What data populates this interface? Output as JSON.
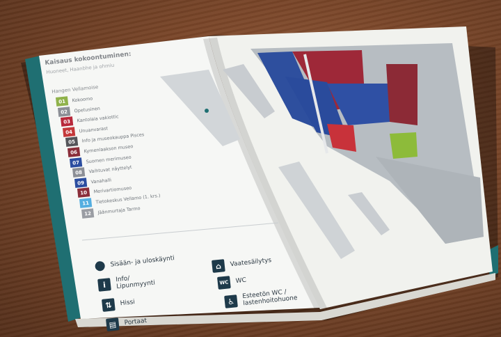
{
  "scene": {
    "description_colors": {
      "table": "#7a4a2e",
      "cover_teal": "#1f6f72",
      "page": "#f5f6f4"
    }
  },
  "left_page": {
    "title": "Kaisaus kokoontuminen:",
    "subtitle": "Huoneet, Haanbhe ja ohmiu",
    "section_heading": "Hangen Vellamoise",
    "legend": [
      {
        "num": "01",
        "label": "Kokoomo",
        "color": "#8fb24a"
      },
      {
        "num": "02",
        "label": "Opetusinen",
        "color": "#8c8f96"
      },
      {
        "num": "03",
        "label": "Kantolaia vakiottic",
        "color": "#b8283a"
      },
      {
        "num": "04",
        "label": "Unuanvarast",
        "color": "#c4383a"
      },
      {
        "num": "05",
        "label": "Info ja museokauppa Pisces",
        "color": "#55555a"
      },
      {
        "num": "06",
        "label": "Kymenlaakson museo",
        "color": "#8a2e3a"
      },
      {
        "num": "07",
        "label": "Suomen merimuseo",
        "color": "#2b4da0"
      },
      {
        "num": "08",
        "label": "Vaihtuvat näyttelyt",
        "color": "#8c8f96"
      },
      {
        "num": "09",
        "label": "Vanahalli",
        "color": "#2b4da0"
      },
      {
        "num": "10",
        "label": "Merivartiomuseo",
        "color": "#8a2e3a"
      },
      {
        "num": "11",
        "label": "Tietokeskus Vellamo (1. krs.)",
        "color": "#55aee0"
      },
      {
        "num": "12",
        "label": "Jäänmurtaja Tarmo",
        "color": "#9a9da3"
      }
    ],
    "key": [
      {
        "icon": "dot",
        "label": "Sisään- ja uloskäynti"
      },
      {
        "icon": "i",
        "label": "Info/\nLipunmyynti"
      },
      {
        "icon": "⇅",
        "label": "Hissi"
      },
      {
        "icon": "▤",
        "label": "Portaat"
      },
      {
        "icon": "⌂",
        "label": "Vaatesäilytys"
      },
      {
        "icon": "WC",
        "label": "WC"
      },
      {
        "icon": "♿",
        "label": "Esteetön WC /\nlastenhoitohuone"
      }
    ]
  }
}
